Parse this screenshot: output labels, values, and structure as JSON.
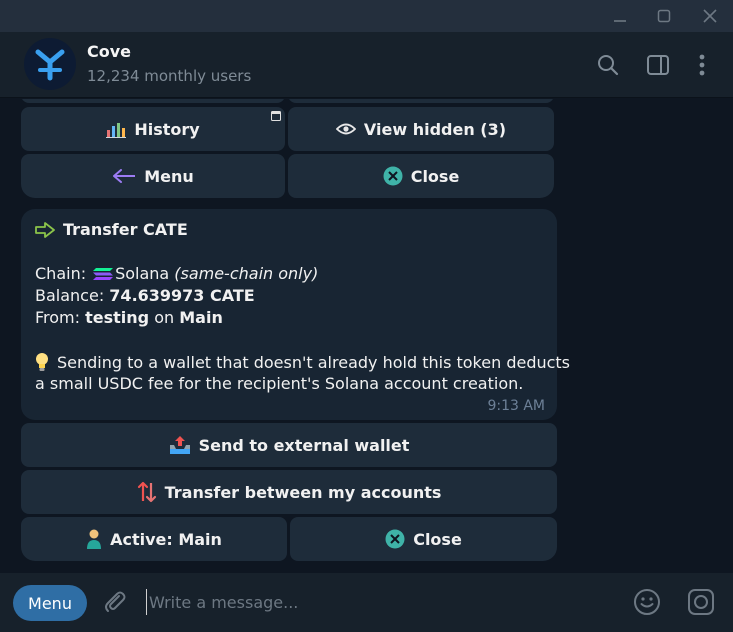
{
  "chat": {
    "title": "Cove",
    "subtitle": "12,234 monthly users"
  },
  "top_keyboard": {
    "history_label": "History",
    "view_hidden_label": "View hidden (3)",
    "menu_label": "Menu",
    "close_label": "Close"
  },
  "message": {
    "heading": "Transfer CATE",
    "chain_label": "Chain:",
    "chain_value": "Solana",
    "chain_note": "(same-chain only)",
    "balance_label": "Balance:",
    "balance_value": "74.639973 CATE",
    "from_label": "From:",
    "from_account": "testing",
    "from_on": "on",
    "from_wallet": "Main",
    "tip_line1": "Sending to a wallet that doesn't already hold this token deducts",
    "tip_line2": "a small USDC fee for the recipient's Solana account creation.",
    "time": "9:13 AM"
  },
  "bottom_keyboard": {
    "send_external_label": "Send to external wallet",
    "transfer_between_label": "Transfer between my accounts",
    "active_label": "Active: Main",
    "close_label": "Close"
  },
  "composer": {
    "menu_label": "Menu",
    "placeholder": "Write a message..."
  },
  "icons": {
    "accent": "#2f6ea5",
    "close_circle": "#3fb3a8",
    "arrow_green": "#8bc34a"
  }
}
